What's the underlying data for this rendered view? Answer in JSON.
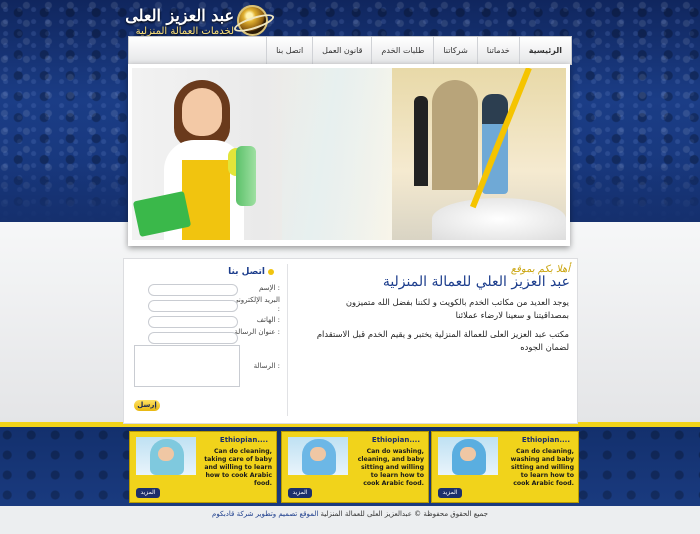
{
  "logo": {
    "name": "عبد العزيز العلى",
    "tagline": "لخدمات العمالة المنزلية",
    "icon": "globe-icon"
  },
  "nav": {
    "items": [
      "الرئيسية",
      "خدماتنا",
      "شركاتنا",
      "طلبات الخدم",
      "قانون العمل",
      "اتصل بنا"
    ],
    "active_index": 0
  },
  "intro": {
    "small": "أهلا بكم بموقع",
    "title": "عبد العزيز العلي للعمالة المنزلية",
    "p1": "يوجد العديد من مكاتب الخدم بالكويت و لكننا بفضل الله متميزون بمصداقيتنا و سعينا لارضاء عملائنا",
    "p2": "مكتب عبد العزيز العلى للعمالة المنزلية يختبر و يقيم الخدم قبل الاستقدام لضمان الجوده"
  },
  "contact": {
    "title": "اتصل بنا",
    "name_label": "الإسم :",
    "email_label": "البريد الإلكتروني :",
    "phone_label": "الهاتف :",
    "subject_label": "عنوان الرسالة :",
    "message_label": "الرسالة :",
    "send": "إرسل"
  },
  "cards": [
    {
      "title": "Ethiopian....",
      "body": "Can do cleaning, taking care of baby and willing to learn how to cook Arabic food.",
      "more": "المزيد"
    },
    {
      "title": "Ethiopian....",
      "body": "Can do washing, cleaning, and baby sitting and willing to learn how to cook Arabic food.",
      "more": "المزيد"
    },
    {
      "title": "Ethiopian....",
      "body": "Can do cleaning, washing and baby sitting and willing to learn how to cook Arabic food.",
      "more": "المزيد"
    }
  ],
  "footer": {
    "text": "جميع الحقوق محفوظة © عبدالعزيز العلى للعمالة المنزلية",
    "credit": "الموقع تصميم وتطوير شركة قادبكوم"
  },
  "colors": {
    "brand_blue": "#1c3d8c",
    "accent_yellow": "#f1d31b"
  }
}
